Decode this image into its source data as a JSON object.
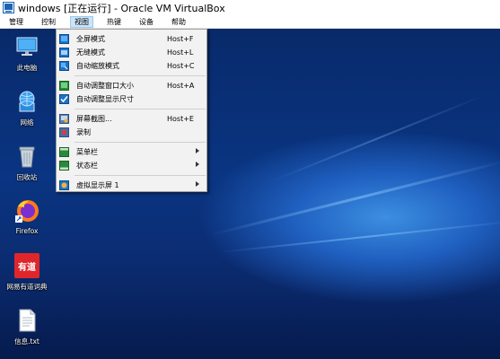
{
  "window": {
    "title": "windows [正在运行] - Oracle VM VirtualBox"
  },
  "menubar": {
    "items": [
      "管理",
      "控制",
      "视图",
      "热键",
      "设备",
      "帮助"
    ],
    "active_index": 2
  },
  "view_menu": {
    "items": [
      {
        "label": "全屏模式",
        "shortcut": "Host+F"
      },
      {
        "label": "无缝模式",
        "shortcut": "Host+L"
      },
      {
        "label": "自动缩放模式",
        "shortcut": "Host+C"
      },
      {
        "label": "自动调整窗口大小",
        "shortcut": "Host+A"
      },
      {
        "label": "自动调整显示尺寸",
        "shortcut": ""
      },
      {
        "label": "屏幕截图...",
        "shortcut": "Host+E"
      },
      {
        "label": "录制",
        "shortcut": ""
      },
      {
        "label": "菜单栏",
        "shortcut": "",
        "submenu": true
      },
      {
        "label": "状态栏",
        "shortcut": "",
        "submenu": true
      },
      {
        "label": "虚拟显示屏 1",
        "shortcut": "",
        "submenu": true
      }
    ]
  },
  "desktop": {
    "icons": [
      {
        "label": "此电脑",
        "icon": "this-pc-icon"
      },
      {
        "label": "网络",
        "icon": "network-icon"
      },
      {
        "label": "回收站",
        "icon": "recycle-bin-icon"
      },
      {
        "label": "Firefox",
        "icon": "firefox-icon"
      },
      {
        "label": "网易有道词典",
        "icon": "youdao-dict-icon",
        "badge_text": "有道"
      },
      {
        "label": "信息.txt",
        "icon": "text-file-icon"
      }
    ]
  },
  "colors": {
    "menu_highlight": "#cce4f7",
    "desktop_bg": "#0b2a6e",
    "youdao_red": "#e0262b",
    "virtualbox_blue": "#1b64b4"
  }
}
